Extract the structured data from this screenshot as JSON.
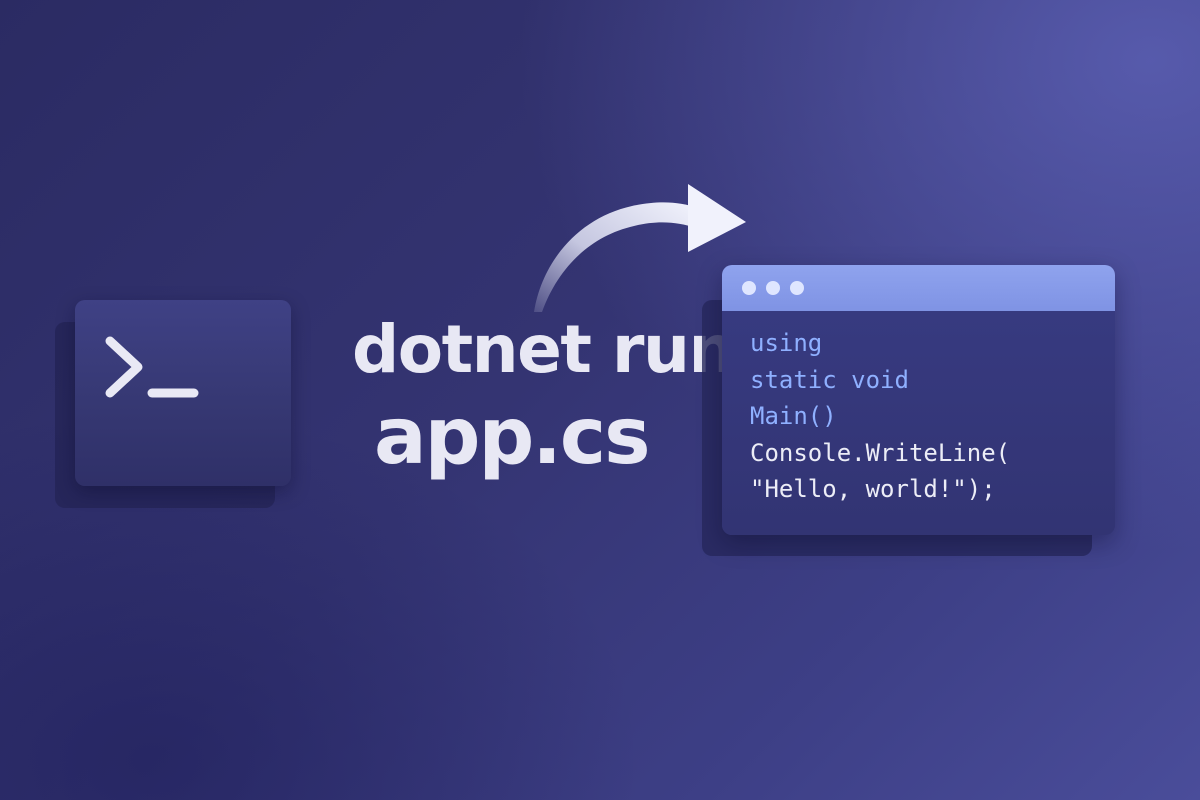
{
  "colors": {
    "background": "#343472",
    "accent_blue": "#8fb0ff",
    "window_bar": "#8fa3ee",
    "text_light": "#e8e8f4"
  },
  "terminal": {
    "icon": "terminal-prompt-icon"
  },
  "command": {
    "line1": "dotnet run",
    "line2": "app.cs"
  },
  "arrow": {
    "icon": "curved-arrow-right-icon"
  },
  "code_window": {
    "lines": [
      "using",
      "static void",
      "Main()",
      "Console.WriteLine(",
      "\"Hello, world!\");"
    ]
  }
}
